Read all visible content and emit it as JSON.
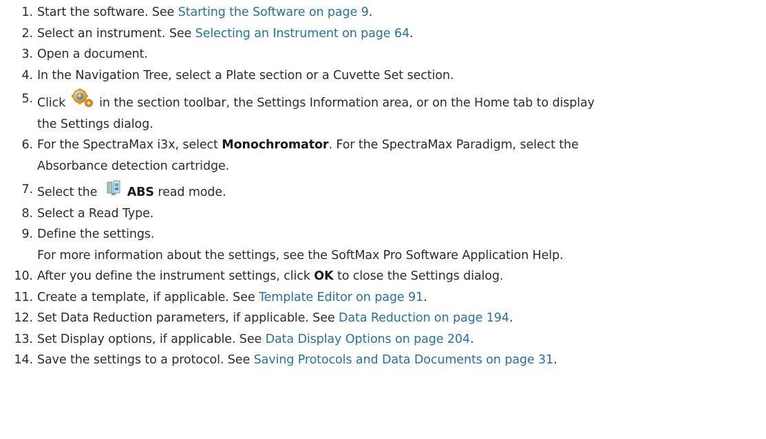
{
  "steps": [
    {
      "num": "1.",
      "text": "Start the software. See ",
      "link": "Starting the Software on page 9",
      "after": "."
    },
    {
      "num": "2.",
      "text": "Select an instrument. See ",
      "link": "Selecting an Instrument on page 64",
      "after": "."
    },
    {
      "num": "3.",
      "text": "Open a document."
    },
    {
      "num": "4.",
      "text": "In the Navigation Tree, select a Plate section or a Cuvette Set section."
    },
    {
      "num": "5.",
      "text_before": "Click ",
      "icon": "settings-gear-icon",
      "text_after": " in the section toolbar, the Settings Information area, or on the Home tab to display",
      "line2": "the Settings dialog."
    },
    {
      "num": "6.",
      "text_before": "For the SpectraMax i3x, select ",
      "ui": "Monochromator",
      "text_after": ". For the SpectraMax Paradigm, select the",
      "line2": "Absorbance detection cartridge."
    },
    {
      "num": "7.",
      "text_before": "Select the ",
      "icon": "abs-read-mode-icon",
      "ui": "ABS",
      "text_after": " read mode."
    },
    {
      "num": "8.",
      "text": "Select a Read Type."
    },
    {
      "num": "9.",
      "text": "Define the settings.",
      "line2": "For more information about the settings, see the SoftMax Pro Software Application Help."
    },
    {
      "num": "10.",
      "text_before": "After you define the instrument settings, click ",
      "ui": "OK",
      "text_after": " to close the Settings dialog."
    },
    {
      "num": "11.",
      "text": "Create a template, if applicable. See ",
      "link": "Template Editor on page 91",
      "after": "."
    },
    {
      "num": "12.",
      "text": "Set Data Reduction parameters, if applicable. See ",
      "link": "Data Reduction on page 194",
      "after": "."
    },
    {
      "num": "13.",
      "text": "Set Display options, if applicable. See ",
      "link": "Data Display Options on page 204",
      "after": "."
    },
    {
      "num": "14.",
      "text": "Save the settings to a protocol. See ",
      "link": "Saving Protocols and Data Documents on page 31",
      "after": "."
    }
  ],
  "colors": {
    "text": "#2b2b2b",
    "link": "#2272a8"
  }
}
